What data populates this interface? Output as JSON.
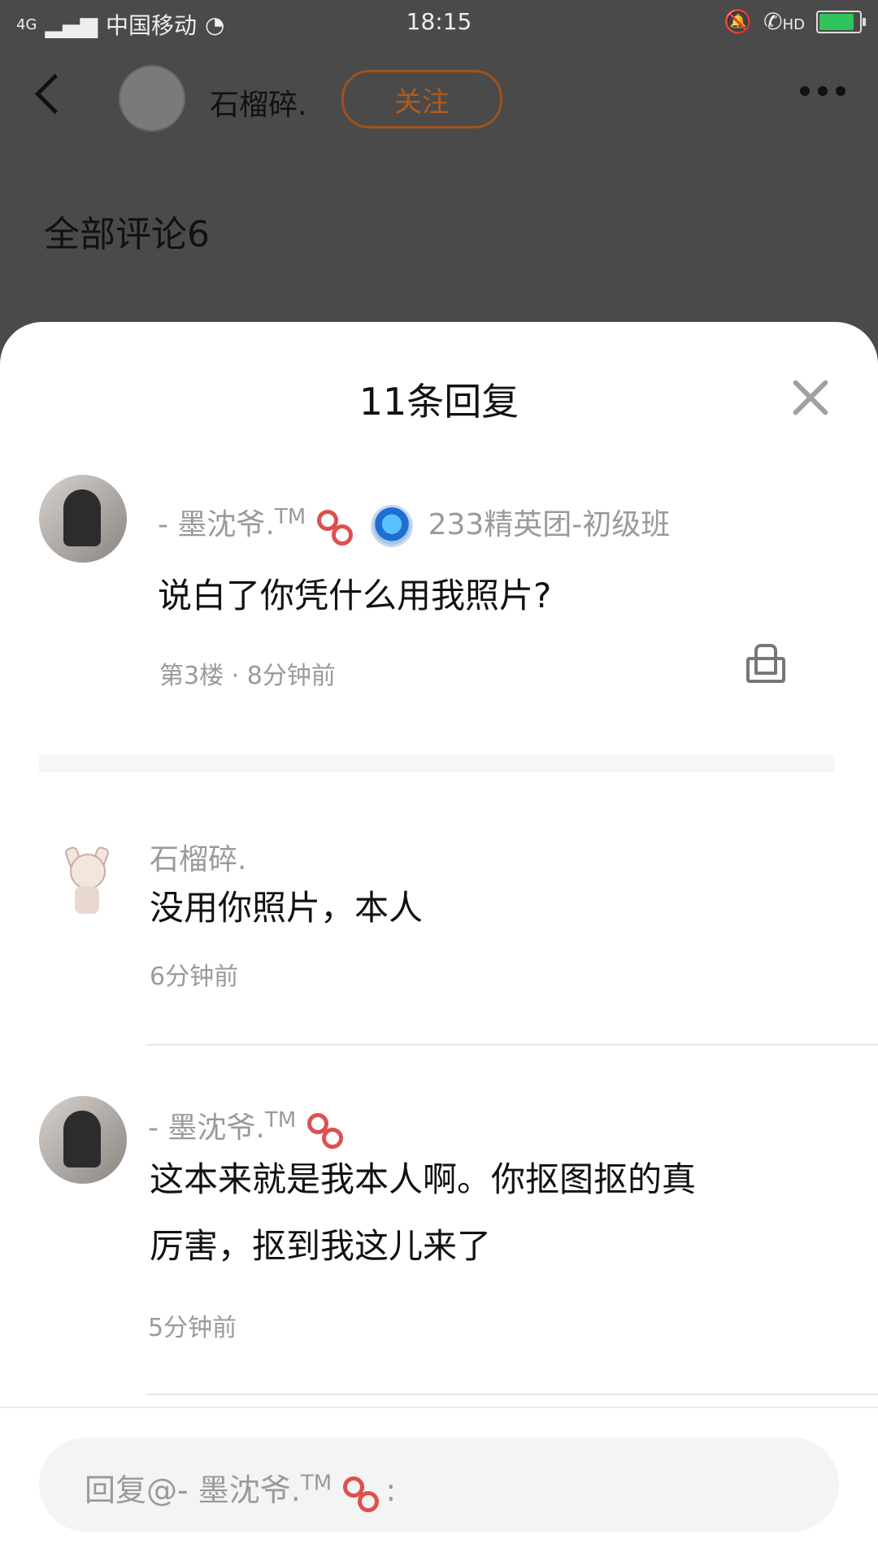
{
  "status_bar": {
    "network": "4G",
    "carrier": "中国移动",
    "time": "18:15",
    "hd": "HD"
  },
  "header": {
    "author": "石榴碎.",
    "follow_label": "关注",
    "all_comments": "全部评论6"
  },
  "sheet": {
    "title": "11条回复",
    "root_comment": {
      "user": "- 墨沈爷.",
      "user_suffix": "TM",
      "group": "233精英团-初级班",
      "text": "说白了你凭什么用我照片?",
      "meta": "第3楼 · 8分钟前"
    },
    "replies": [
      {
        "user": "石榴碎.",
        "text": "没用你照片，本人",
        "time": "6分钟前"
      },
      {
        "user": "- 墨沈爷.",
        "user_suffix": "TM",
        "text_line1": "这本来就是我本人啊。你抠图抠的真",
        "text_line2": "厉害，抠到我这儿来了",
        "time": "5分钟前"
      }
    ],
    "reply_placeholder_prefix": "回复@- 墨沈爷.",
    "reply_placeholder_suffix": "TM",
    "reply_placeholder_end": ":"
  }
}
